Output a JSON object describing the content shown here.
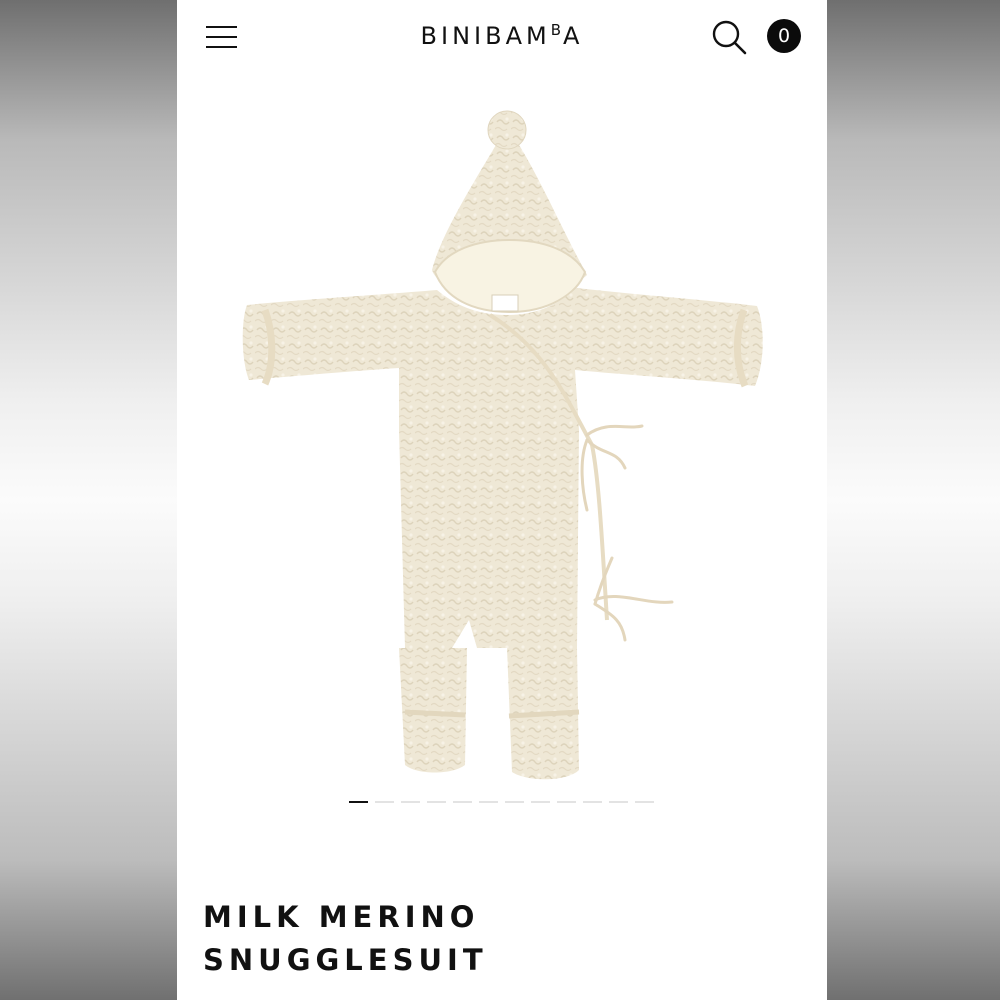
{
  "header": {
    "logo_main": "BINIBAM",
    "logo_sup": "B",
    "logo_end": "A",
    "cart_count": "0",
    "icons": {
      "menu": "hamburger-menu-icon",
      "search": "search-icon"
    }
  },
  "gallery": {
    "image_subject": "cream sherpa wool hooded snugglesuit",
    "slide_count": 12,
    "active_slide": 1
  },
  "product": {
    "title_line1": "MILK MERINO",
    "title_line2": "SNUGGLESUIT"
  },
  "colors": {
    "text": "#111111",
    "cart_badge": "#0b0b0b",
    "wool": "#efe8d6"
  }
}
